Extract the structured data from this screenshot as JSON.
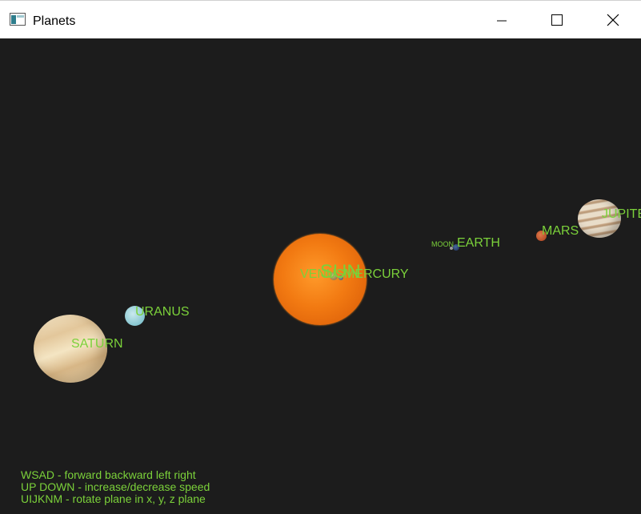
{
  "window": {
    "title": "Planets",
    "icon": "app-window-icon",
    "controls": [
      "minimize-icon",
      "maximize-icon",
      "close-icon"
    ]
  },
  "scene": {
    "background": "#1c1c1c",
    "label_color": "#7bd13a",
    "labels": {
      "sun": "SUN",
      "venus": "VENUS",
      "mercury": "MERCURY",
      "earth": "EARTH",
      "moon": "MOON",
      "mars": "MARS",
      "jupiter": "JUPITER",
      "uranus": "URANUS",
      "saturn": "SATURN"
    }
  },
  "help": {
    "line1": "WSAD - forward backward left right",
    "line2": "UP DOWN - increase/decrease speed",
    "line3": "UIJKNM - rotate plane in x, y, z plane"
  }
}
